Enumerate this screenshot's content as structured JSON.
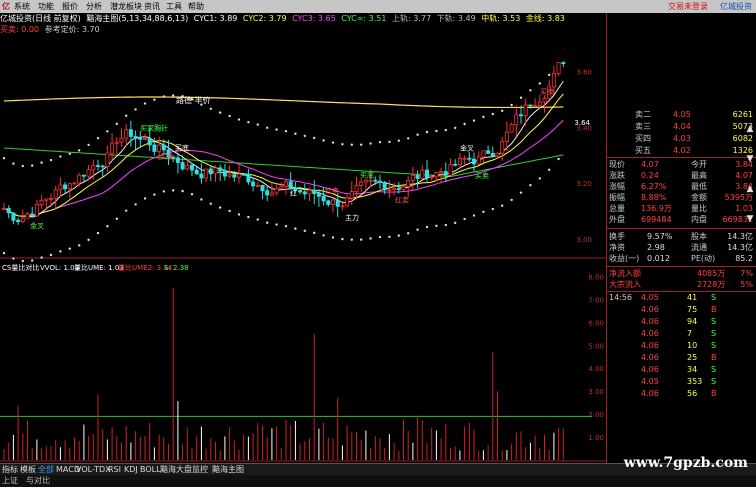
{
  "menu": {
    "brand": "亿",
    "items": [
      "系统",
      "功能",
      "报价",
      "分析",
      "潜龙板块",
      "资讯",
      "工具",
      "帮助"
    ],
    "right_link": "交易未登录",
    "right_brand": "亿城投资"
  },
  "header1": {
    "title": "亿城投资(日线 前复权)",
    "indicator": "黯海主图(5,13,34,88,6,13)",
    "cyc1": "CYC1: 3.89",
    "cyc2": "CYC2: 3.79",
    "cyc3": "CYC3: 3.65",
    "cycx": "CYC∞: 3.51",
    "up": "上轨: 3.77",
    "down": "下轨: 3.49",
    "mid": "中轨: 3.53",
    "gold": "金线: 3.83"
  },
  "header2": {
    "a": "买卖: 0.00",
    "b": "参考定价: 3.70"
  },
  "price_labels": {
    "peak": "路德·半价",
    "ann": [
      "买家胸针",
      "买卖",
      "买底",
      "金叉",
      "红卖",
      "主力",
      "买底",
      "红卖",
      "金叉",
      "买卖",
      "买卖",
      "红"
    ],
    "right_top": "3.64",
    "axis": [
      "3.60",
      "3.40",
      "3.20",
      "3.00"
    ]
  },
  "vol_header": {
    "a": "CS量比对比",
    "b": "VVOL: 1.03",
    "c": "量比UME: 1.03",
    "d": "量比UME2: 3.44",
    "e": "S: 2.38"
  },
  "vol_axis": [
    "8.00",
    "7.00",
    "6.00",
    "5.00",
    "4.00",
    "3.00",
    "2.00",
    "1.00"
  ],
  "date_axis": [
    "2014年",
    "5",
    "6",
    "7",
    "8"
  ],
  "order_book": {
    "sells": [
      {
        "label": "卖二",
        "price": "4.05",
        "vol": "6261"
      },
      {
        "label": "卖三",
        "price": "4.04",
        "vol": "5073"
      },
      {
        "label": "买四",
        "price": "4.03",
        "vol": "6082"
      },
      {
        "label": "买五",
        "price": "4.02",
        "vol": "1326"
      }
    ]
  },
  "stats": [
    {
      "l1": "现价",
      "v1": "4.07",
      "l2": "今开",
      "v2": "3.84"
    },
    {
      "l1": "涨跌",
      "v1": "0.24",
      "l2": "最高",
      "v2": "4.07"
    },
    {
      "l1": "涨幅",
      "v1": "6.27%",
      "l2": "最低",
      "v2": "3.84"
    },
    {
      "l1": "振幅",
      "v1": "8.88%",
      "l2": "金额",
      "v2": "5395万"
    },
    {
      "l1": "总量",
      "v1": "136.9万",
      "l2": "量比",
      "v2": "1.03"
    },
    {
      "l1": "外盘",
      "v1": "699484",
      "l2": "内盘",
      "v2": "669832"
    }
  ],
  "stats2": [
    {
      "l1": "换手",
      "v1": "9.57%",
      "l2": "股本",
      "v2": "14.3亿"
    },
    {
      "l1": "净资",
      "v1": "2.98",
      "l2": "流通",
      "v2": "14.3亿"
    },
    {
      "l1": "收益(一)",
      "v1": "0.012",
      "l2": "PE(动)",
      "v2": "85.2"
    }
  ],
  "flows": [
    {
      "label": "净流入额",
      "v": "4085万",
      "p": "7%"
    },
    {
      "label": "大宗流入",
      "v": "2728万",
      "p": "5%"
    }
  ],
  "ticks": [
    {
      "t": "14:56",
      "p": "4.05",
      "v": "41",
      "s": "S"
    },
    {
      "t": "",
      "p": "4.06",
      "v": "75",
      "s": "B"
    },
    {
      "t": "",
      "p": "4.06",
      "v": "94",
      "s": "S"
    },
    {
      "t": "",
      "p": "4.06",
      "v": "7",
      "s": "S"
    },
    {
      "t": "",
      "p": "4.06",
      "v": "10",
      "s": "S"
    },
    {
      "t": "",
      "p": "4.06",
      "v": "25",
      "s": "B"
    },
    {
      "t": "",
      "p": "4.06",
      "v": "34",
      "s": "S"
    },
    {
      "t": "",
      "p": "4.05",
      "v": "353",
      "s": "S"
    },
    {
      "t": "",
      "p": "4.06",
      "v": "56",
      "s": "B"
    }
  ],
  "tabs": [
    "指标",
    "模板",
    "全部",
    "MACD",
    "VOL-TDX",
    "RSI",
    "KDJ",
    "BOLL",
    "黯海大盘监控",
    "黯海主图"
  ],
  "bottom": {
    "a": "上证",
    "b": "与对比"
  },
  "watermark": "www.7gpzb.com"
}
